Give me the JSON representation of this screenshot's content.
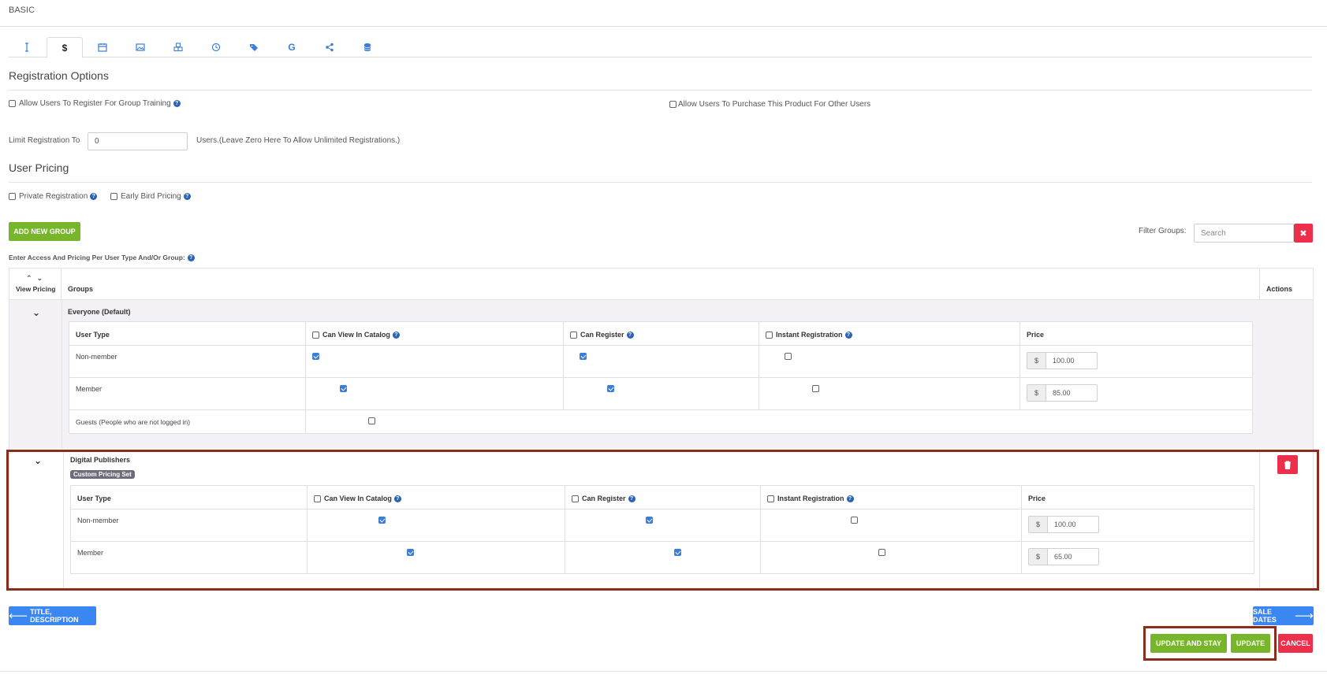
{
  "header": {
    "title": "BASIC"
  },
  "tabs": [
    {
      "icon": "text-cursor-icon"
    },
    {
      "icon": "dollar-icon",
      "label": "$"
    },
    {
      "icon": "calendar-icon"
    },
    {
      "icon": "image-icon"
    },
    {
      "icon": "cubes-icon"
    },
    {
      "icon": "clock-icon"
    },
    {
      "icon": "tags-icon"
    },
    {
      "icon": "google-icon",
      "label": "G"
    },
    {
      "icon": "share-icon"
    },
    {
      "icon": "database-icon"
    }
  ],
  "registration": {
    "title": "Registration Options",
    "group_training_label": "Allow Users To Register For Group Training",
    "purchase_for_others_label": "Allow Users To Purchase This Product For Other Users",
    "limit_label": "Limit Registration To",
    "limit_value": "0",
    "limit_suffix": "Users.(Leave Zero Here To Allow Unlimited Registrations.)"
  },
  "user_pricing": {
    "title": "User Pricing",
    "private_label": "Private Registration",
    "early_bird_label": "Early Bird Pricing",
    "add_group_label": "ADD NEW GROUP",
    "filter_label": "Filter Groups:",
    "filter_placeholder": "Search",
    "enter_access_label": "Enter Access And Pricing Per User Type And/Or Group:"
  },
  "grid": {
    "col_view_pricing": "View Pricing",
    "col_groups": "Groups",
    "col_actions": "Actions",
    "sub_headers": {
      "user_type": "User Type",
      "can_view": "Can View In Catalog",
      "can_register": "Can Register",
      "instant": "Instant Registration",
      "price": "Price"
    },
    "currency": "$",
    "groups": [
      {
        "name": "Everyone (Default)",
        "rows": [
          {
            "type": "Non-member",
            "view": true,
            "register": true,
            "instant": false,
            "price": "100.00"
          },
          {
            "type": "Member",
            "view": true,
            "register": true,
            "instant": false,
            "price": "85.00"
          },
          {
            "type": "Guests (People who are not logged in)",
            "view": false
          }
        ]
      },
      {
        "name": "Digital Publishers",
        "badge": "Custom Pricing Set",
        "rows": [
          {
            "type": "Non-member",
            "view": true,
            "register": true,
            "instant": false,
            "price": "100.00"
          },
          {
            "type": "Member",
            "view": true,
            "register": true,
            "instant": false,
            "price": "65.00"
          }
        ]
      }
    ]
  },
  "footer": {
    "back_label": "TITLE, DESCRIPTION",
    "next_label": "SALE DATES",
    "update_stay_label": "UPDATE AND STAY",
    "update_label": "UPDATE",
    "cancel_label": "CANCEL"
  },
  "colors": {
    "accent_blue": "#3a86f2",
    "green": "#77b52a",
    "red": "#ec2f4b",
    "highlight": "#8b2c1c"
  }
}
